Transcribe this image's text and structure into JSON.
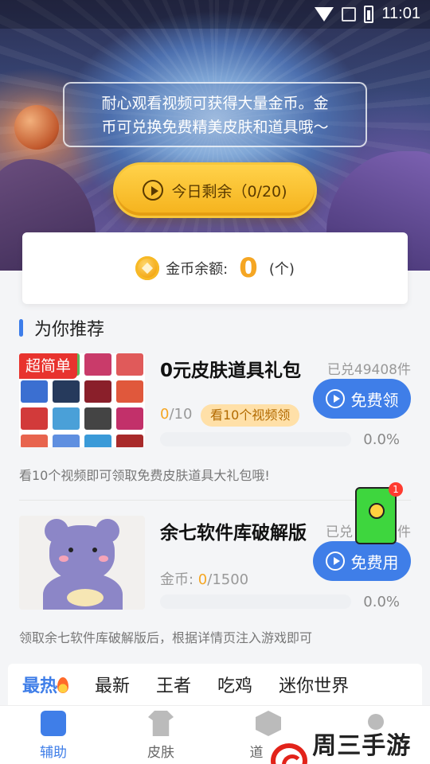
{
  "status_bar": {
    "time": "11:01"
  },
  "hero": {
    "notice_line1": "耐心观看视频可获得大量金币。金",
    "notice_line2": "币可兑换免费精美皮肤和道具哦～",
    "watch_button_label": "今日剩余（0/20)"
  },
  "balance": {
    "label": "金币余额:",
    "value": "0",
    "unit": "(个)"
  },
  "section": {
    "title": "为你推荐"
  },
  "items": [
    {
      "badge": "超简单",
      "title": "0元皮肤道具礼包",
      "exchanged": "已兑49408件",
      "progress_current": "0",
      "progress_total": "/10",
      "tip": "看10个视频领",
      "button": "免费领",
      "progress_percent": "0.0%",
      "progress_fraction": 0.0,
      "description": "看10个视频即可领取免费皮肤道具大礼包哦!"
    },
    {
      "title": "余七软件库破解版",
      "exchanged": "已兑",
      "exchanged_suffix": "件",
      "progress_prefix": "金币: ",
      "progress_current": "0",
      "progress_total": "/1500",
      "button": "免费用",
      "progress_percent": "0.0%",
      "progress_fraction": 0.0,
      "description": "领取余七软件库破解版后，根据详情页注入游戏即可"
    }
  ],
  "red_packet": {
    "count": "1"
  },
  "category_tabs": [
    "最热",
    "最新",
    "王者",
    "吃鸡",
    "迷你世界"
  ],
  "bottom_nav": [
    "辅助",
    "皮肤",
    "道"
  ],
  "watermark": "周三手游网",
  "colors": {
    "accent": "#3f7ee8",
    "coin": "#f5a623",
    "badge_red": "#e8332e"
  }
}
